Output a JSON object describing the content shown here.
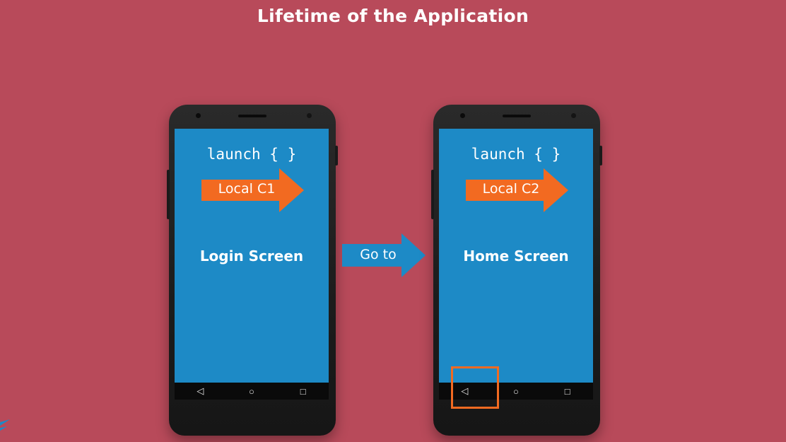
{
  "title": "Lifetime of the Application",
  "colors": {
    "background": "#b84a5a",
    "screen": "#1d8ac6",
    "orange_arrow": "#f26a21",
    "blue_arrow": "#1d8ac6",
    "highlight": "#f26a21"
  },
  "phones": [
    {
      "code": "launch { }",
      "arrow_label": "Local C1",
      "screen_label": "Login Screen",
      "nav_icons": [
        "back-icon",
        "home-icon",
        "recents-icon"
      ],
      "nav_glyphs": [
        "◁",
        "○",
        "□"
      ]
    },
    {
      "code": "launch { }",
      "arrow_label": "Local C2",
      "screen_label": "Home Screen",
      "nav_icons": [
        "back-icon",
        "home-icon",
        "recents-icon"
      ],
      "nav_glyphs": [
        "◁",
        "○",
        "□"
      ]
    }
  ],
  "connector": {
    "label": "Go to"
  },
  "highlight": {
    "target": "back-icon"
  }
}
